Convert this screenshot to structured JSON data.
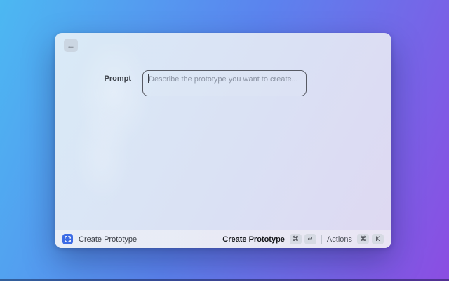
{
  "colors": {
    "wallpaper_gradient_start": "#4cb8f2",
    "wallpaper_gradient_end": "#8b4de2",
    "accent_blue": "#3d6ce5",
    "window_background_top": "#d9eaf7",
    "window_background_bottom": "#ded8f2"
  },
  "icons": {
    "back": "arrow-left-icon",
    "command": "viewfinder-icon"
  },
  "window": {
    "header": {
      "back_glyph": "←"
    },
    "form": {
      "prompt_label": "Prompt",
      "prompt_value": "",
      "prompt_placeholder": "Describe the prototype you want to create..."
    },
    "footer": {
      "command_name": "Create Prototype",
      "primary_action": {
        "label": "Create Prototype",
        "keys": [
          "⌘",
          "↵"
        ]
      },
      "actions_menu": {
        "label": "Actions",
        "keys": [
          "⌘",
          "K"
        ]
      }
    }
  }
}
